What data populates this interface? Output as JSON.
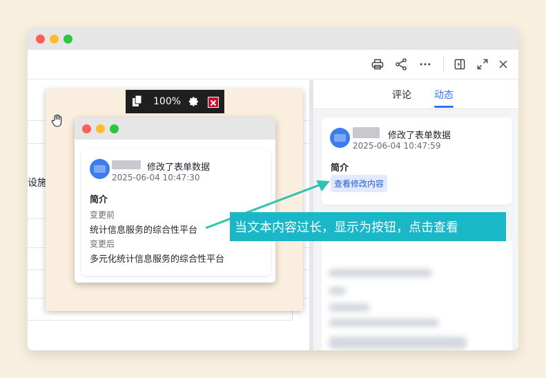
{
  "window": {
    "toolbar_icons": [
      "printer-icon",
      "share-icon",
      "more-icon",
      "sidebar-toggle-icon",
      "expand-icon",
      "close-icon"
    ]
  },
  "left_pane": {
    "partial_label": "设施"
  },
  "right_pane": {
    "tabs": [
      {
        "label": "评论",
        "active": false
      },
      {
        "label": "动态",
        "active": true
      }
    ],
    "activity": {
      "action": "修改了表单数据",
      "time": "2025-06-04 10:47:59",
      "summary_label": "简介",
      "view_button": "查看修改内容"
    }
  },
  "viewer": {
    "zoom": "100%",
    "icons": [
      "copy-icon",
      "gear-icon",
      "close-icon"
    ]
  },
  "popup": {
    "action": "修改了表单数据",
    "time": "2025-06-04 10:47:30",
    "summary_label": "简介",
    "before_label": "变更前",
    "before_value": "统计信息服务的综合性平台",
    "after_label": "变更后",
    "after_value": "多元化统计信息服务的综合性平台"
  },
  "callout": {
    "text": "当文本内容过长，显示为按钮，点击查看"
  },
  "colors": {
    "accent": "#3370ff",
    "callout": "#1ab7c9",
    "arrow": "#2bc4b0"
  }
}
